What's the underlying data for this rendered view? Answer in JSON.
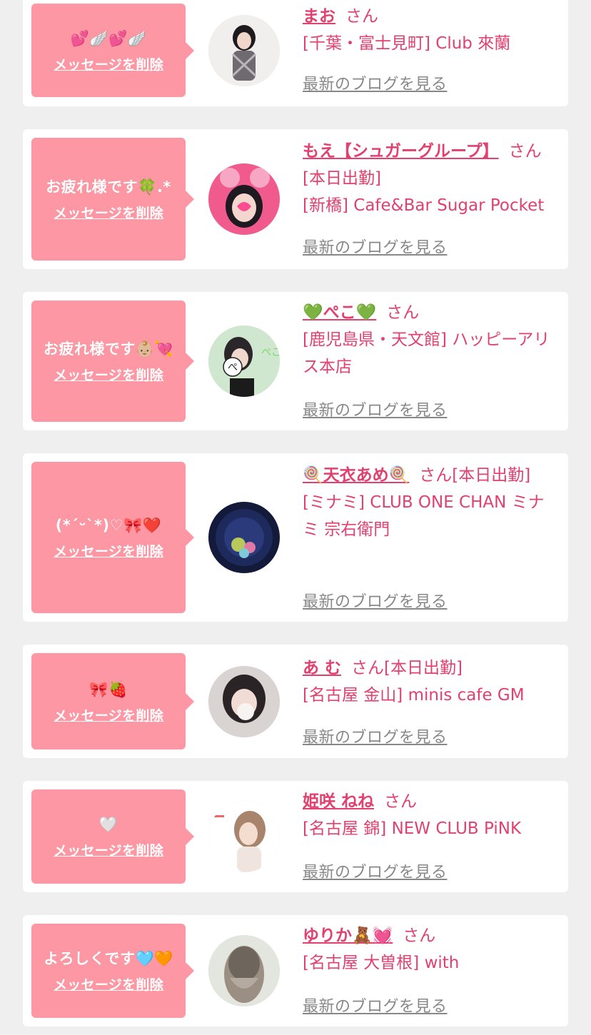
{
  "delete_label": "メッセージを削除",
  "blog_label": "最新のブログを見る",
  "san_label": "さん",
  "cards": [
    {
      "message": "💕🪽💕🪽",
      "name": "まお",
      "name_suffix": "",
      "shop": "[千葉・富士見町] Club 來蘭"
    },
    {
      "message": "お疲れ様です🍀.*",
      "name": "もえ【シュガーグループ】",
      "name_suffix": "[本日出勤]",
      "shop": "[新橋] Cafe&Bar Sugar Pocket"
    },
    {
      "message": "お疲れ様です👶🏼💘",
      "name": "💚ぺこ💚",
      "name_suffix": "",
      "shop": "[鹿児島県・天文館] ハッピーアリス本店"
    },
    {
      "message": "(*´ᵕ`*)♡🎀❤️",
      "name": "🍭天衣あめ🍭",
      "name_suffix": "[本日出勤]",
      "shop": "[ミナミ] CLUB ONE CHAN ミナミ 宗右衛門"
    },
    {
      "message": "🎀🍓",
      "name": "あ む",
      "name_suffix": "[本日出勤]",
      "shop": "[名古屋 金山] minis cafe GM"
    },
    {
      "message": "🤍",
      "name": "姫咲 ねね",
      "name_suffix": "",
      "shop": "[名古屋 錦] NEW CLUB PiNK"
    },
    {
      "message": "よろしくです🩵🧡",
      "name": "ゆりか🧸💓",
      "name_suffix": "",
      "shop": "[名古屋 大曽根] with"
    }
  ]
}
